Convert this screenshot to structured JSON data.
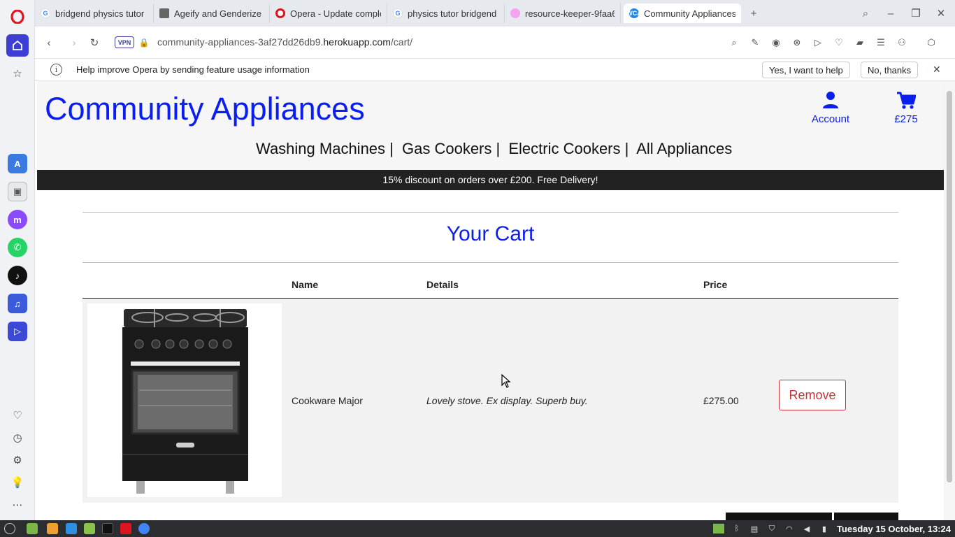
{
  "browser": {
    "tabs": [
      {
        "title": "bridgend physics tutor",
        "favicon": "google-icon"
      },
      {
        "title": "Ageify and Genderize a",
        "favicon": "document-icon"
      },
      {
        "title": "Opera - Update comple",
        "favicon": "opera-icon"
      },
      {
        "title": "physics tutor bridgend",
        "favicon": "google-icon"
      },
      {
        "title": "resource-keeper-9faa6",
        "favicon": "circle-icon"
      },
      {
        "title": "Community Appliances",
        "favicon": "ca-icon",
        "favicon_text": "WCA",
        "active": true
      }
    ],
    "url_prefix": "community-appliances-3af27dd26db9.",
    "url_host": "herokuapp.com",
    "url_path": "/cart/",
    "vpn_label": "VPN",
    "infobar": {
      "text": "Help improve Opera by sending feature usage information",
      "yes_label": "Yes, I want to help",
      "no_label": "No, thanks"
    }
  },
  "site": {
    "title": "Community Appliances",
    "account_label": "Account",
    "cart_total": "£275",
    "nav": [
      "Washing Machines |",
      "Gas Cookers |",
      "Electric Cookers |",
      "All Appliances"
    ],
    "promo": "15% discount on orders over £200. Free Delivery!"
  },
  "cart": {
    "heading": "Your Cart",
    "columns": {
      "name": "Name",
      "details": "Details",
      "price": "Price"
    },
    "items": [
      {
        "name": "Cookware Major",
        "details": "Lovely stove. Ex display. Superb buy.",
        "price": "£275.00",
        "remove_label": "Remove"
      }
    ]
  },
  "system": {
    "clock": "Tuesday 15 October, 13:24"
  },
  "colors": {
    "brand_blue": "#0b1ef0",
    "remove_red": "#c9323a",
    "opera_red": "#e0141e"
  }
}
